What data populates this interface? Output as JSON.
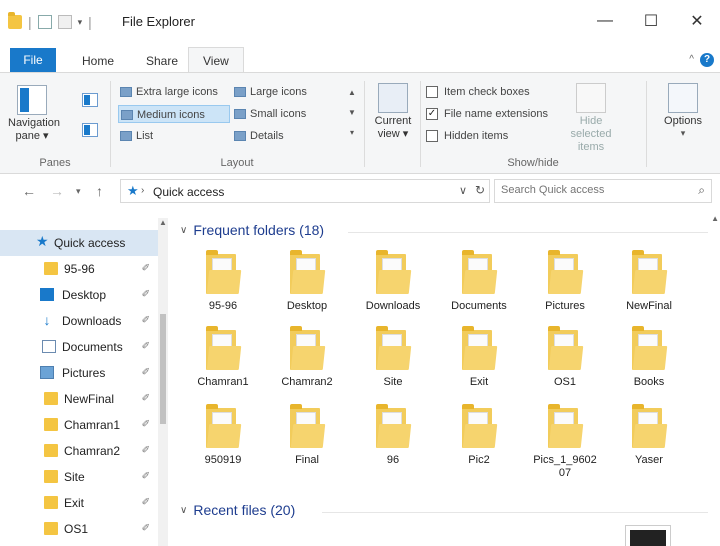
{
  "window": {
    "title": "File Explorer",
    "minimize": "—",
    "maximize": "☐",
    "close": "✕"
  },
  "ribbon_tabs": [
    {
      "label": "File"
    },
    {
      "label": "Home"
    },
    {
      "label": "Share"
    },
    {
      "label": "View"
    }
  ],
  "ribbon": {
    "panes": {
      "group_label": "Panes",
      "navigation_pane": "Navigation pane ▾"
    },
    "layout": {
      "group_label": "Layout",
      "items": [
        {
          "label": "Extra large icons"
        },
        {
          "label": "Large icons"
        },
        {
          "label": "Medium icons"
        },
        {
          "label": "Small icons"
        },
        {
          "label": "List"
        },
        {
          "label": "Details"
        }
      ],
      "selected": "Medium icons"
    },
    "current_view": "Current view ▾",
    "show_hide": {
      "group_label": "Show/hide",
      "item_check_boxes": {
        "label": "Item check boxes",
        "checked": false
      },
      "file_name_extensions": {
        "label": "File name extensions",
        "checked": true
      },
      "hidden_items": {
        "label": "Hidden items",
        "checked": false
      },
      "hide_selected_items": "Hide selected items"
    },
    "options": "Options"
  },
  "address": {
    "breadcrumb": "Quick access",
    "search_placeholder": "Search Quick access"
  },
  "sidebar": {
    "items": [
      {
        "label": "Quick access",
        "icon": "star-icon",
        "pinned": false
      },
      {
        "label": "95-96",
        "icon": "folder-icon",
        "pinned": true
      },
      {
        "label": "Desktop",
        "icon": "desktop-icon",
        "pinned": true
      },
      {
        "label": "Downloads",
        "icon": "downloads-icon",
        "pinned": true
      },
      {
        "label": "Documents",
        "icon": "documents-icon",
        "pinned": true
      },
      {
        "label": "Pictures",
        "icon": "pictures-icon",
        "pinned": true
      },
      {
        "label": "NewFinal",
        "icon": "folder-icon",
        "pinned": true
      },
      {
        "label": "Chamran1",
        "icon": "folder-icon",
        "pinned": true
      },
      {
        "label": "Chamran2",
        "icon": "folder-icon",
        "pinned": true
      },
      {
        "label": "Site",
        "icon": "folder-icon",
        "pinned": true
      },
      {
        "label": "Exit",
        "icon": "folder-icon",
        "pinned": true
      },
      {
        "label": "OS1",
        "icon": "folder-icon",
        "pinned": true
      }
    ]
  },
  "frequent_folders": {
    "heading": "Frequent folders (18)",
    "items": [
      {
        "label": "95-96"
      },
      {
        "label": "Desktop"
      },
      {
        "label": "Downloads"
      },
      {
        "label": "Documents"
      },
      {
        "label": "Pictures"
      },
      {
        "label": "NewFinal"
      },
      {
        "label": "Chamran1"
      },
      {
        "label": "Chamran2"
      },
      {
        "label": "Site"
      },
      {
        "label": "Exit"
      },
      {
        "label": "OS1"
      },
      {
        "label": "Books"
      },
      {
        "label": "950919"
      },
      {
        "label": "Final"
      },
      {
        "label": "96"
      },
      {
        "label": "Pic2"
      },
      {
        "label": "Pics_1_9602\n07"
      },
      {
        "label": "Yaser"
      }
    ]
  },
  "recent_files": {
    "heading": "Recent files (20)"
  }
}
